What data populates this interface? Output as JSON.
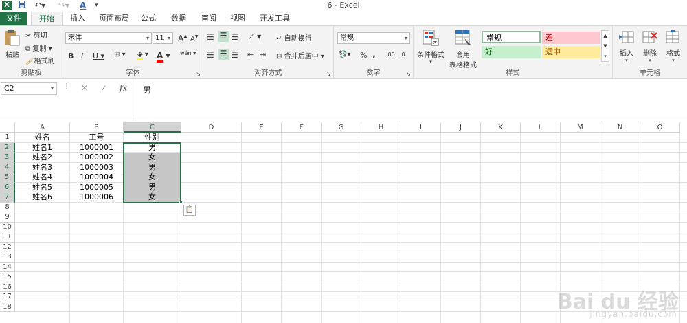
{
  "window": {
    "title": "6 - Excel"
  },
  "quick_access": {
    "app_icon": "X",
    "save_icon": "save-icon",
    "undo_icon": "undo-icon",
    "redo_icon": "redo-icon",
    "font_color_icon": "A"
  },
  "tabs": [
    "文件",
    "开始",
    "插入",
    "页面布局",
    "公式",
    "数据",
    "审阅",
    "视图",
    "开发工具"
  ],
  "ribbon": {
    "clipboard": {
      "label": "剪贴板",
      "paste": "粘贴",
      "cut": "剪切",
      "copy": "复制",
      "format_painter": "格式刷"
    },
    "font": {
      "label": "字体",
      "font_name": "宋体",
      "font_size": "11",
      "bold": "B",
      "italic": "I",
      "underline": "U",
      "grow": "A",
      "shrink": "A",
      "font_color": "A",
      "phonetic": "wén"
    },
    "alignment": {
      "label": "对齐方式",
      "wrap_text": "自动换行",
      "merge_center": "合并后居中"
    },
    "number": {
      "label": "数字",
      "format": "常规",
      "percent": "%",
      "comma": ",",
      "inc_decimal": ".00",
      "dec_decimal": ".0"
    },
    "styles": {
      "label": "样式",
      "conditional_format": "条件格式",
      "format_as_table_1": "套用",
      "format_as_table_2": "表格格式",
      "normal": "常规",
      "bad": "差",
      "good": "好",
      "neutral": "适中"
    },
    "cells": {
      "label": "单元格",
      "insert": "插入",
      "delete": "删除",
      "format": "格式"
    }
  },
  "formula_bar": {
    "name_box": "C2",
    "fx": "fx",
    "cancel": "✕",
    "enter": "✓",
    "value": "男"
  },
  "columns": [
    "A",
    "B",
    "C",
    "D",
    "E",
    "F",
    "G",
    "H",
    "I",
    "J",
    "K",
    "L",
    "M",
    "N",
    "O"
  ],
  "rows": [
    "1",
    "2",
    "3",
    "4",
    "5",
    "6",
    "7",
    "8",
    "9",
    "10",
    "11",
    "12",
    "13",
    "14",
    "15",
    "16",
    "17",
    "18"
  ],
  "table": {
    "headers": [
      "姓名",
      "工号",
      "性别"
    ],
    "rows": [
      [
        "姓名1",
        "1000001",
        "男"
      ],
      [
        "姓名2",
        "1000002",
        "女"
      ],
      [
        "姓名3",
        "1000003",
        "男"
      ],
      [
        "姓名4",
        "1000004",
        "女"
      ],
      [
        "姓名5",
        "1000005",
        "男"
      ],
      [
        "姓名6",
        "1000006",
        "女"
      ]
    ]
  },
  "watermark": {
    "main": "Bai du 经验",
    "sub": "jingyan.baidu.com"
  },
  "colors": {
    "excel_green": "#217346",
    "bad_bg": "#ffc7ce",
    "bad_fg": "#9c0006",
    "good_bg": "#c6efce",
    "good_fg": "#006100",
    "neutral_bg": "#ffeb9c",
    "neutral_fg": "#9c5700",
    "selection_shade": "#c6c6c6"
  }
}
